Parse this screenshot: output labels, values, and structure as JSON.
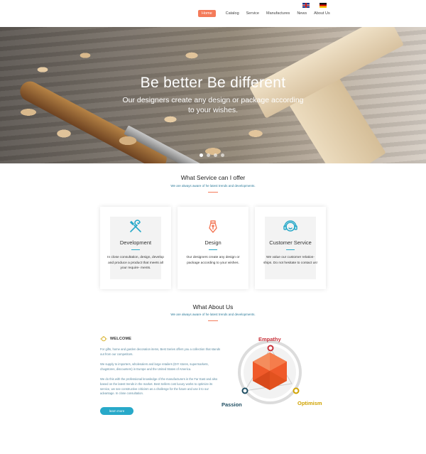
{
  "nav": {
    "flags": [
      "uk-flag-icon",
      "de-flag-icon"
    ],
    "items": [
      {
        "label": "Home",
        "active": true
      },
      {
        "label": "Catalog",
        "active": false
      },
      {
        "label": "Service",
        "active": false
      },
      {
        "label": "Manufactures",
        "active": false
      },
      {
        "label": "News",
        "active": false
      },
      {
        "label": "About Us",
        "active": false
      }
    ]
  },
  "hero": {
    "title": "Be better Be different",
    "subtitle_line1": "Our designers create any design or package according",
    "subtitle_line2": "to your wishes.",
    "slides": 4,
    "active_slide": 1
  },
  "services": {
    "title": "What Service can I offer",
    "subtitle": "We are always aware of he latest trends and developments.",
    "cards": [
      {
        "icon": "tools-icon",
        "title": "Development",
        "text": "In close consultation, design, develop and produce a product that meets all your require- ments."
      },
      {
        "icon": "pen-nib-icon",
        "title": "Design",
        "text": "Our designers create any design or package according to your wishes."
      },
      {
        "icon": "headset-icon",
        "title": "Customer Service",
        "text": "We value our customer relation- ships. Do not hesitate to contact us!"
      }
    ]
  },
  "about": {
    "title": "What  About Us",
    "subtitle": "We are always aware of he latest trends and developments.",
    "welcome": "WELCOME",
    "paragraphs": [
      "For gifts, home and garden decoration items, Best Series offers you a collection that stands out from our competitors.",
      "We supply to importers, wholesalers and large retailers (DIY stores, supermarkets, chagstores, discounters) in Europe and the United States of America.",
      "We do this with the professional knowledge of the manufacturers in the Far East and also based on the latest trends in the market. Best Sellers cost luxury works to optimize its service, we see constructive criticism as a challenge for the future and use it to our advantage. In close consultation."
    ],
    "button": "learn more",
    "values": {
      "empathy": "Empathy",
      "passion": "Passion",
      "optimism": "Optimism"
    }
  },
  "colors": {
    "accent": "#f47b5a",
    "teal": "#28a9c9",
    "empathy": "#c8313a",
    "passion": "#1f4e62",
    "optimism": "#d1a300"
  }
}
